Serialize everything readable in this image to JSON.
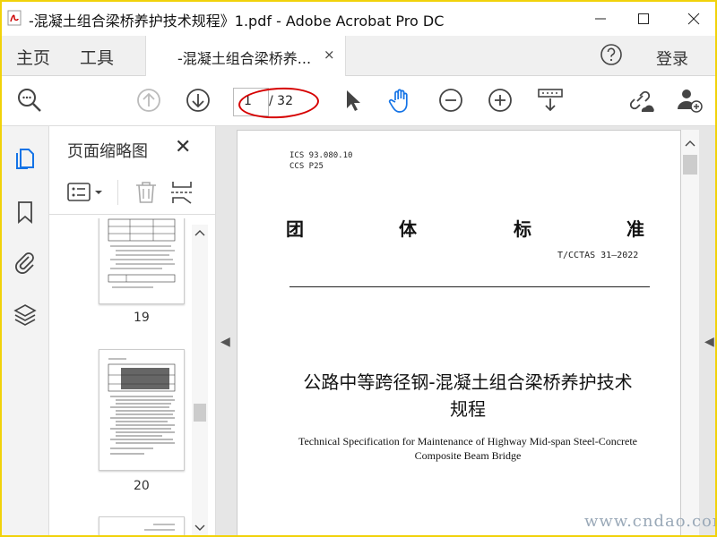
{
  "window": {
    "title": "-混凝土组合梁桥养护技术规程》1.pdf - Adobe Acrobat Pro DC",
    "border_color": "#f1d20a"
  },
  "tabs": {
    "home": "主页",
    "tools": "工具",
    "document_tab": "-混凝土组合梁桥养...",
    "close_glyph": "×",
    "login": "登录"
  },
  "toolbar": {
    "page_current": "1",
    "page_total": "/ 32",
    "accent": "#1473e6"
  },
  "sidebar": {
    "panel_title": "页面缩略图",
    "close_glyph": "✕",
    "thumbnails": [
      {
        "page": "19"
      },
      {
        "page": "20"
      }
    ]
  },
  "document": {
    "ics": "ICS  93.080.10",
    "ccs": "CCS  P25",
    "standard_chars": [
      "团",
      "体",
      "标",
      "准"
    ],
    "standard_code": "T/CCTAS 31—2022",
    "title_cn_line1": "公路中等跨径钢-混凝土组合梁桥养护技术",
    "title_cn_line2": "规程",
    "title_en_line1": "Technical Specification for Maintenance of Highway Mid-span Steel-Concrete",
    "title_en_line2": "Composite Beam Bridge"
  },
  "watermark": "www.cndao.com"
}
